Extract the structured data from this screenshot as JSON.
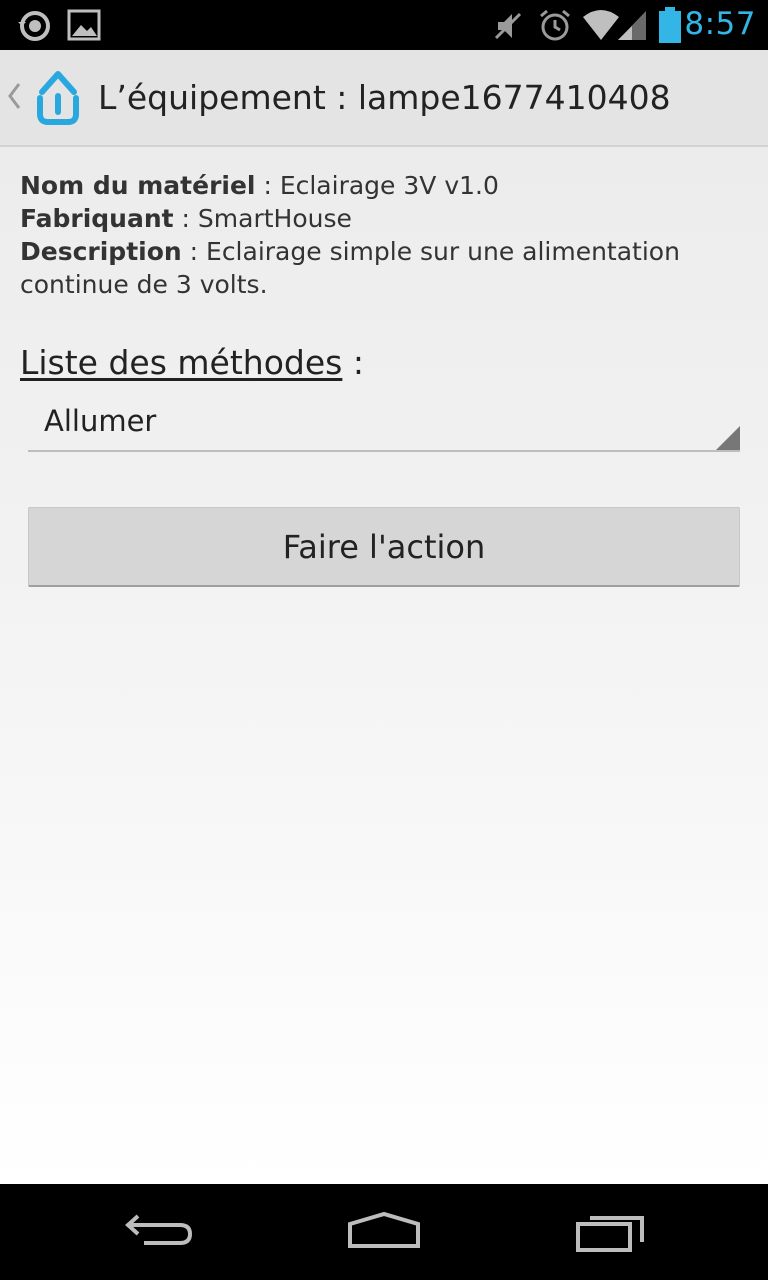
{
  "status_bar": {
    "time": "8:57",
    "icons": [
      "sync-icon",
      "picture-icon",
      "mute-icon",
      "alarm-icon",
      "wifi-icon",
      "signal-icon",
      "battery-icon"
    ],
    "accent_color": "#33b5e5"
  },
  "action_bar": {
    "title": "L’équipement : lampe1677410408"
  },
  "device": {
    "name_label": "Nom du matériel",
    "name_value": " : Eclairage 3V v1.0",
    "maker_label": "Fabriquant",
    "maker_value": " : SmartHouse",
    "description_label": "Description",
    "description_value": " : Eclairage simple sur une alimentation continue de 3 volts."
  },
  "methods": {
    "label": "Liste des méthodes",
    "separator": " :",
    "selected": "Allumer"
  },
  "action_button": {
    "label": "Faire l'action"
  },
  "nav_bar": {
    "buttons": [
      "back-icon",
      "home-icon",
      "recents-icon"
    ]
  }
}
